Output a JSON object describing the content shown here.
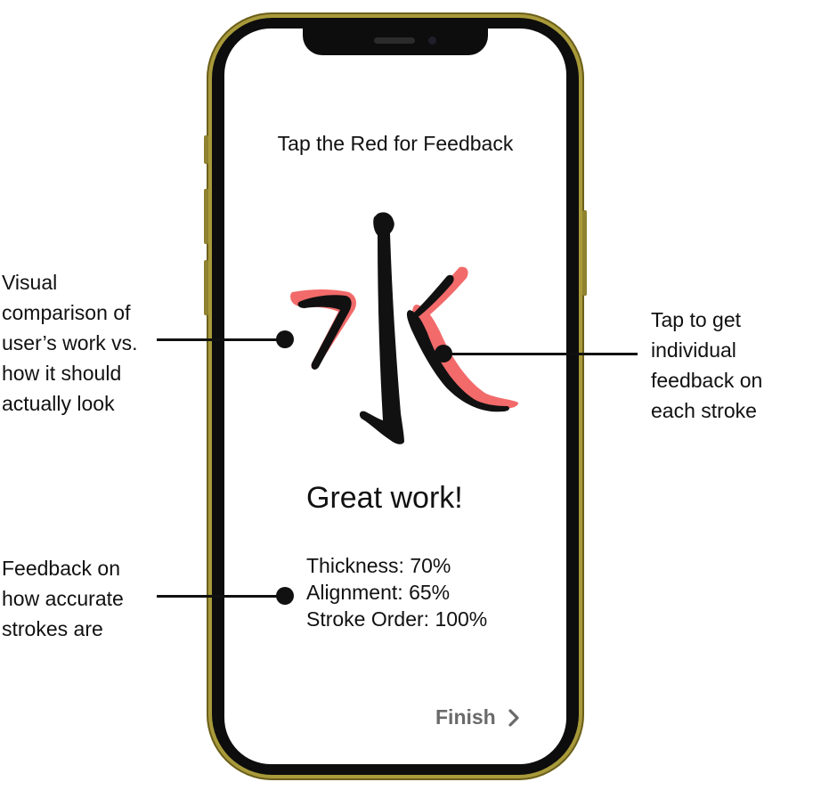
{
  "screen": {
    "title": "Tap the Red for Feedback",
    "character": "水",
    "result_heading": "Great work!",
    "stats": [
      {
        "label": "Thickness:",
        "value": "70%"
      },
      {
        "label": "Alignment:",
        "value": "65%"
      },
      {
        "label": "Stroke Order:",
        "value": "100%"
      }
    ],
    "finish_label": "Finish",
    "finish_icon": "chevron-right-icon"
  },
  "annotations": {
    "visual_comparison": "Visual\ncomparison of\nuser’s work vs.\nhow it should\nactually look",
    "stroke_feedback": "Tap to get\nindividual\nfeedback on\neach stroke",
    "accuracy_feedback": "Feedback on\nhow accurate\nstrokes are"
  },
  "colors": {
    "ink": "#111111",
    "correction_red": "#f26a6a",
    "finish_gray": "#6a6a6a",
    "phone_frame": "#a89a3a"
  }
}
